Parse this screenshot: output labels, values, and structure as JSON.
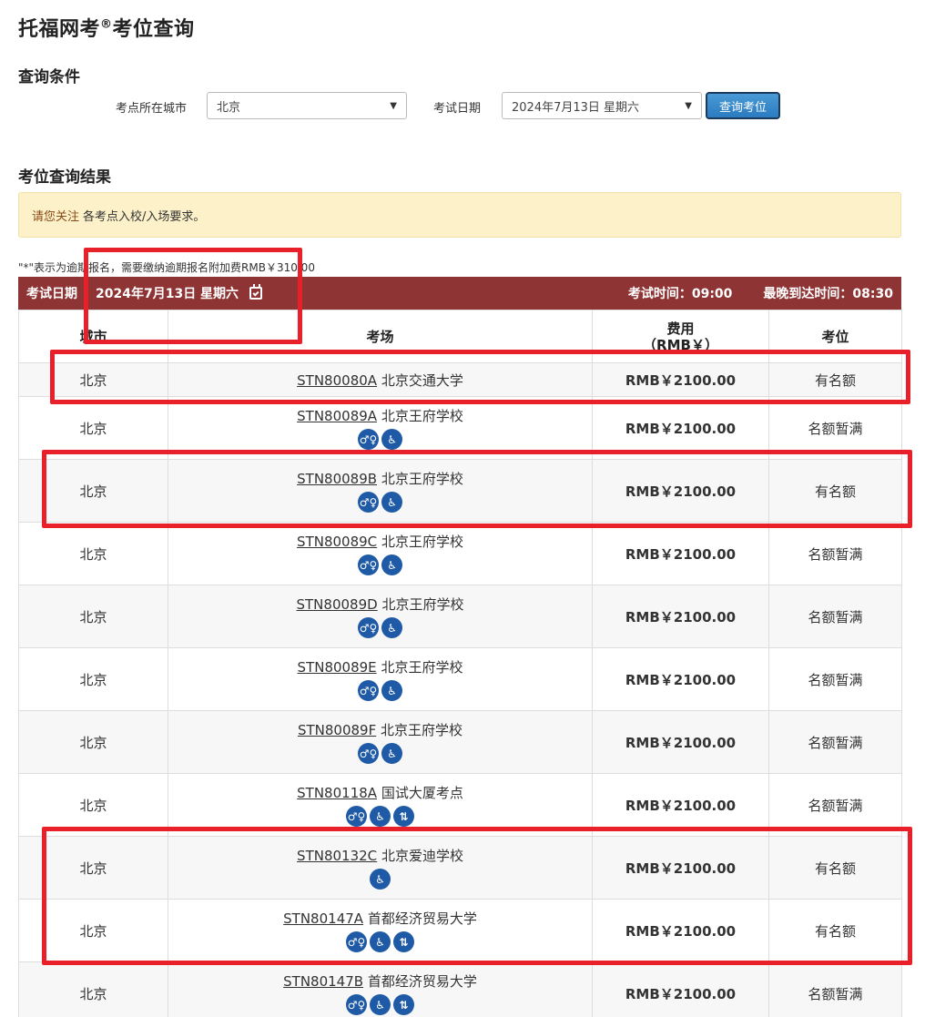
{
  "page": {
    "title": "托福网考",
    "title_sup": "®",
    "title_suffix": "考位查询"
  },
  "query": {
    "section_title": "查询条件",
    "city_label": "考点所在城市",
    "city_value": "北京",
    "date_label": "考试日期",
    "date_value": "2024年7月13日 星期六",
    "button_label": "查询考位"
  },
  "results": {
    "section_title": "考位查询结果",
    "notice_link": "请您关注",
    "notice_text": "各考点入校/入场要求。",
    "late_note": "\"*\"表示为逾期报名，需要缴纳逾期报名附加费RMB￥310.00",
    "date_label": "考试日期",
    "date_value": "2024年7月13日 星期六",
    "exam_time": "考试时间：09:00",
    "latest_arrival": "最晚到达时间：08:30",
    "headers": {
      "city": "城市",
      "center": "考场",
      "fee_line1": "费用",
      "fee_line2": "（RMB￥）",
      "seat": "考位"
    },
    "rows": [
      {
        "city": "北京",
        "code": "STN80080A",
        "name": "北京交通大学",
        "fee": "RMB￥2100.00",
        "seat": "有名额",
        "icons": []
      },
      {
        "city": "北京",
        "code": "STN80089A",
        "name": "北京王府学校",
        "fee": "RMB￥2100.00",
        "seat": "名额暂满",
        "icons": [
          "restroom-icon",
          "wheelchair-icon"
        ]
      },
      {
        "city": "北京",
        "code": "STN80089B",
        "name": "北京王府学校",
        "fee": "RMB￥2100.00",
        "seat": "有名额",
        "icons": [
          "restroom-icon",
          "wheelchair-icon"
        ]
      },
      {
        "city": "北京",
        "code": "STN80089C",
        "name": "北京王府学校",
        "fee": "RMB￥2100.00",
        "seat": "名额暂满",
        "icons": [
          "restroom-icon",
          "wheelchair-icon"
        ]
      },
      {
        "city": "北京",
        "code": "STN80089D",
        "name": "北京王府学校",
        "fee": "RMB￥2100.00",
        "seat": "名额暂满",
        "icons": [
          "restroom-icon",
          "wheelchair-icon"
        ]
      },
      {
        "city": "北京",
        "code": "STN80089E",
        "name": "北京王府学校",
        "fee": "RMB￥2100.00",
        "seat": "名额暂满",
        "icons": [
          "restroom-icon",
          "wheelchair-icon"
        ]
      },
      {
        "city": "北京",
        "code": "STN80089F",
        "name": "北京王府学校",
        "fee": "RMB￥2100.00",
        "seat": "名额暂满",
        "icons": [
          "restroom-icon",
          "wheelchair-icon"
        ]
      },
      {
        "city": "北京",
        "code": "STN80118A",
        "name": "国试大厦考点",
        "fee": "RMB￥2100.00",
        "seat": "名额暂满",
        "icons": [
          "restroom-icon",
          "wheelchair-icon",
          "elevator-icon"
        ]
      },
      {
        "city": "北京",
        "code": "STN80132C",
        "name": "北京爱迪学校",
        "fee": "RMB￥2100.00",
        "seat": "有名额",
        "icons": [
          "wheelchair-icon"
        ]
      },
      {
        "city": "北京",
        "code": "STN80147A",
        "name": "首都经济贸易大学",
        "fee": "RMB￥2100.00",
        "seat": "有名额",
        "icons": [
          "restroom-icon",
          "wheelchair-icon",
          "elevator-icon"
        ]
      },
      {
        "city": "北京",
        "code": "STN80147B",
        "name": "首都经济贸易大学",
        "fee": "RMB￥2100.00",
        "seat": "名额暂满",
        "icons": [
          "restroom-icon",
          "wheelchair-icon",
          "elevator-icon"
        ]
      }
    ]
  },
  "colors": {
    "date_bar": "#8e3434",
    "notice_bg": "#fcf1c8",
    "icon_blue": "#1f5aa6",
    "highlight": "#e8202a"
  }
}
